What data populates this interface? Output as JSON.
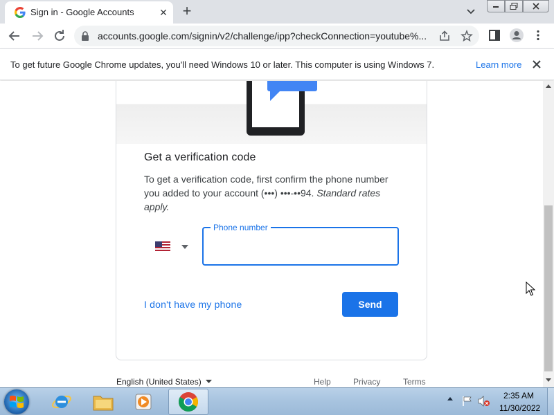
{
  "browser": {
    "tab_title": "Sign in - Google Accounts",
    "url": "accounts.google.com/signin/v2/challenge/ipp?checkConnection=youtube%...",
    "icons": [
      "google-g-icon",
      "tab-close-icon",
      "new-tab-icon",
      "tab-search-icon",
      "back-icon",
      "forward-icon",
      "reload-icon",
      "lock-icon",
      "share-icon",
      "bookmark-star-icon",
      "side-panel-icon",
      "profile-icon",
      "menu-icon"
    ]
  },
  "infobar": {
    "message": "To get future Google Chrome updates, you'll need Windows 10 or later. This computer is using Windows 7.",
    "learn_more": "Learn more"
  },
  "card": {
    "illustration_text": "****",
    "title": "Get a verification code",
    "desc_plain": "To get a verification code, first confirm the phone number you added to your account (•••) •••-••94. ",
    "desc_italic": "Standard rates apply.",
    "phone_label": "Phone number",
    "phone_value": "",
    "country_flag": "us-flag-icon",
    "no_phone_link": "I don't have my phone",
    "send_button": "Send"
  },
  "footer": {
    "language": "English (United States)",
    "help": "Help",
    "privacy": "Privacy",
    "terms": "Terms"
  },
  "taskbar": {
    "time": "2:35 AM",
    "date": "11/30/2022",
    "apps": [
      "internet-explorer-icon",
      "file-explorer-icon",
      "media-player-icon",
      "chrome-icon"
    ]
  },
  "colors": {
    "accent": "#1a73e8",
    "tabstrip": "#dee1e6",
    "omnibox": "#f1f3f4"
  }
}
